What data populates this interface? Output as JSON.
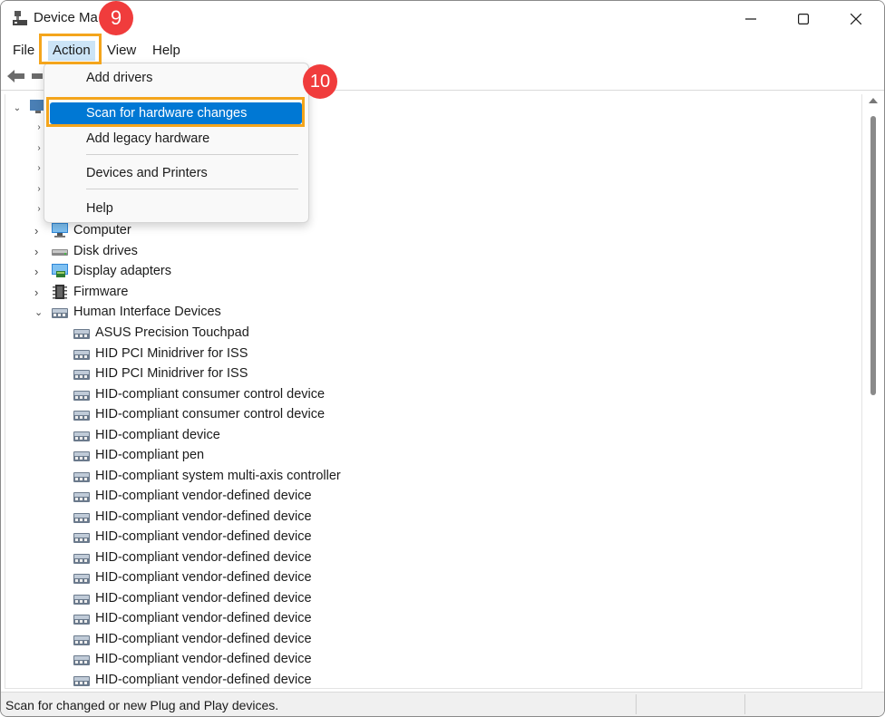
{
  "window": {
    "title": "Device Ma"
  },
  "menubar": {
    "items": [
      "File",
      "Action",
      "View",
      "Help"
    ],
    "active": "Action"
  },
  "action_menu": {
    "items": [
      "Add drivers",
      "Scan for hardware changes",
      "Add legacy hardware",
      "Devices and Printers",
      "Help"
    ],
    "selected": "Scan for hardware changes"
  },
  "tree": {
    "categories": [
      {
        "label": "Computer",
        "icon": "computer-icon",
        "expanded": false
      },
      {
        "label": "Disk drives",
        "icon": "disk-drive-icon",
        "expanded": false
      },
      {
        "label": "Display adapters",
        "icon": "display-adapter-icon",
        "expanded": false
      },
      {
        "label": "Firmware",
        "icon": "firmware-icon",
        "expanded": false
      },
      {
        "label": "Human Interface Devices",
        "icon": "hid-icon",
        "expanded": true
      }
    ],
    "hid_devices": [
      "ASUS Precision Touchpad",
      "HID PCI Minidriver for ISS",
      "HID PCI Minidriver for ISS",
      "HID-compliant consumer control device",
      "HID-compliant consumer control device",
      "HID-compliant device",
      "HID-compliant pen",
      "HID-compliant system multi-axis controller",
      "HID-compliant vendor-defined device",
      "HID-compliant vendor-defined device",
      "HID-compliant vendor-defined device",
      "HID-compliant vendor-defined device",
      "HID-compliant vendor-defined device",
      "HID-compliant vendor-defined device",
      "HID-compliant vendor-defined device",
      "HID-compliant vendor-defined device",
      "HID-compliant vendor-defined device",
      "HID-compliant vendor-defined device"
    ]
  },
  "status": {
    "text": "Scan for changed or new Plug and Play devices."
  },
  "callouts": {
    "step_9": "9",
    "step_10": "10"
  },
  "colors": {
    "accent": "#0078d4",
    "highlight_box": "#f4a51c",
    "badge": "#f03c3c"
  }
}
